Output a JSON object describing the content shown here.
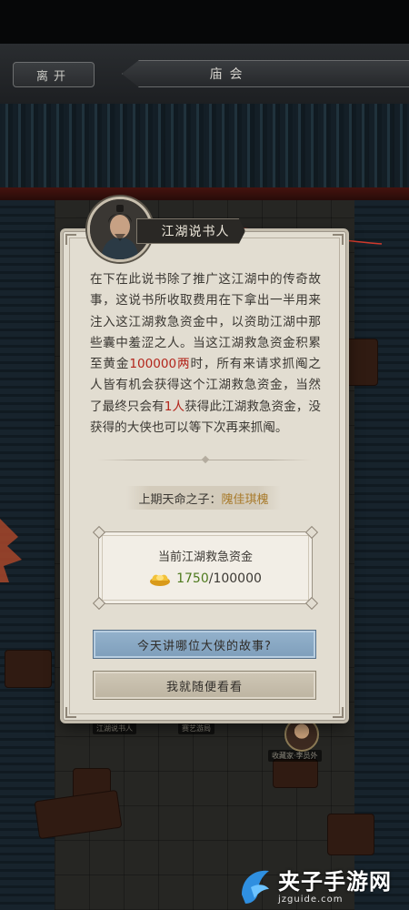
{
  "header": {
    "leave_label": "离开",
    "title": "庙会"
  },
  "scene": {
    "sign_storyteller": "江湖说书人",
    "sign_mid": "赛艺游局",
    "sign_collector": "收藏家·李员外"
  },
  "dialog": {
    "npc_name": "江湖说书人",
    "story": {
      "part1": "在下在此说书除了推广这江湖中的传奇故事，这说书所收取费用在下拿出一半用来注入这江湖救急资金中，以资助江湖中那些囊中羞涩之人。当这江湖救急资金积累至黄金",
      "amount": "100000两",
      "part2": "时，所有来请求抓阄之人皆有机会获得这个江湖救急资金，当然了最终只会有",
      "winners": "1人",
      "part3": "获得此江湖救急资金，没获得的大侠也可以等下次再来抓阄。"
    },
    "previous_label": "上期天命之子：",
    "previous_name": "隗佳琪槐",
    "fund": {
      "title": "当前江湖救急资金",
      "current": "1750",
      "separator": "/",
      "target": "100000"
    },
    "button_listen": "今天讲哪位大侠的故事?",
    "button_browse": "我就随便看看"
  },
  "watermark": {
    "name": "夹子手游网",
    "domain": "jzguide.com"
  },
  "colors": {
    "highlight": "#b3251b",
    "fund_current": "#4e7a1e",
    "primary_button": "#8aa8c4"
  }
}
